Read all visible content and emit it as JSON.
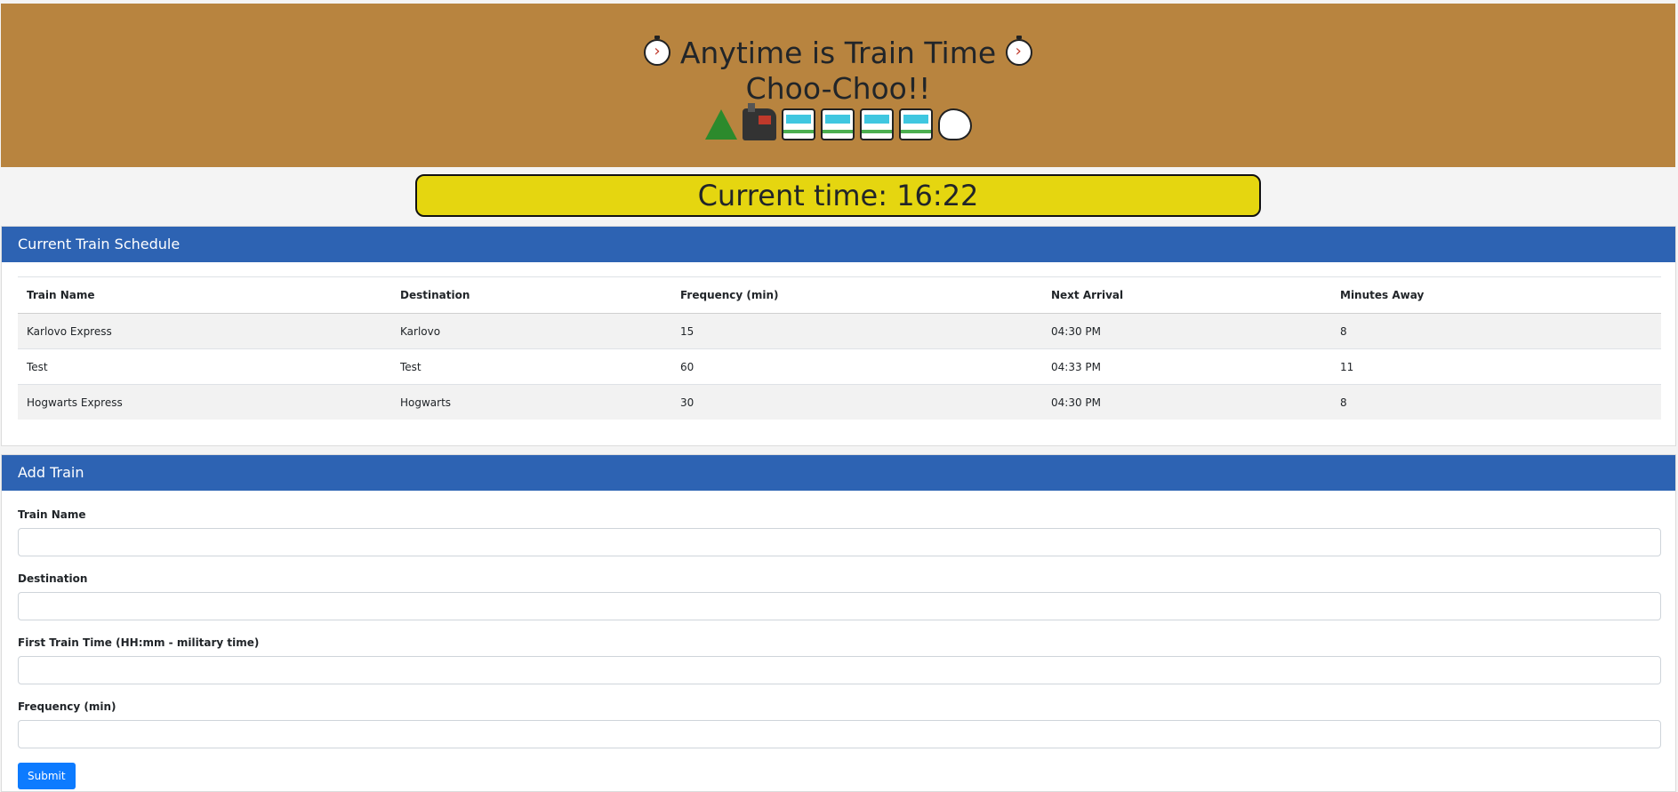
{
  "header": {
    "title_line1": "Anytime is Train Time",
    "title_line2": "Choo-Choo!!",
    "icons": [
      "stopwatch-icon",
      "mountain-railway-icon",
      "locomotive-icon",
      "railway-car-icon",
      "railway-car-icon",
      "railway-car-icon",
      "railway-car-icon",
      "dashing-away-icon"
    ]
  },
  "clock": {
    "text": "Current time: 16:22"
  },
  "schedule": {
    "title": "Current Train Schedule",
    "columns": [
      "Train Name",
      "Destination",
      "Frequency (min)",
      "Next Arrival",
      "Minutes Away"
    ],
    "rows": [
      [
        "Karlovo Express",
        "Karlovo",
        "15",
        "04:30 PM",
        "8"
      ],
      [
        "Test",
        "Test",
        "60",
        "04:33 PM",
        "11"
      ],
      [
        "Hogwarts Express",
        "Hogwarts",
        "30",
        "04:30 PM",
        "8"
      ]
    ]
  },
  "add_train": {
    "title": "Add Train",
    "fields": [
      {
        "label": "Train Name",
        "value": "",
        "placeholder": ""
      },
      {
        "label": "Destination",
        "value": "",
        "placeholder": ""
      },
      {
        "label": "First Train Time (HH:mm - military time)",
        "value": "",
        "placeholder": ""
      },
      {
        "label": "Frequency (min)",
        "value": "",
        "placeholder": ""
      }
    ],
    "submit_label": "Submit"
  },
  "colors": {
    "header_bg": "#b8843f",
    "clock_bg": "#e5d610",
    "card_header_bg": "#2d63b3",
    "submit_bg": "#0d7bff"
  }
}
